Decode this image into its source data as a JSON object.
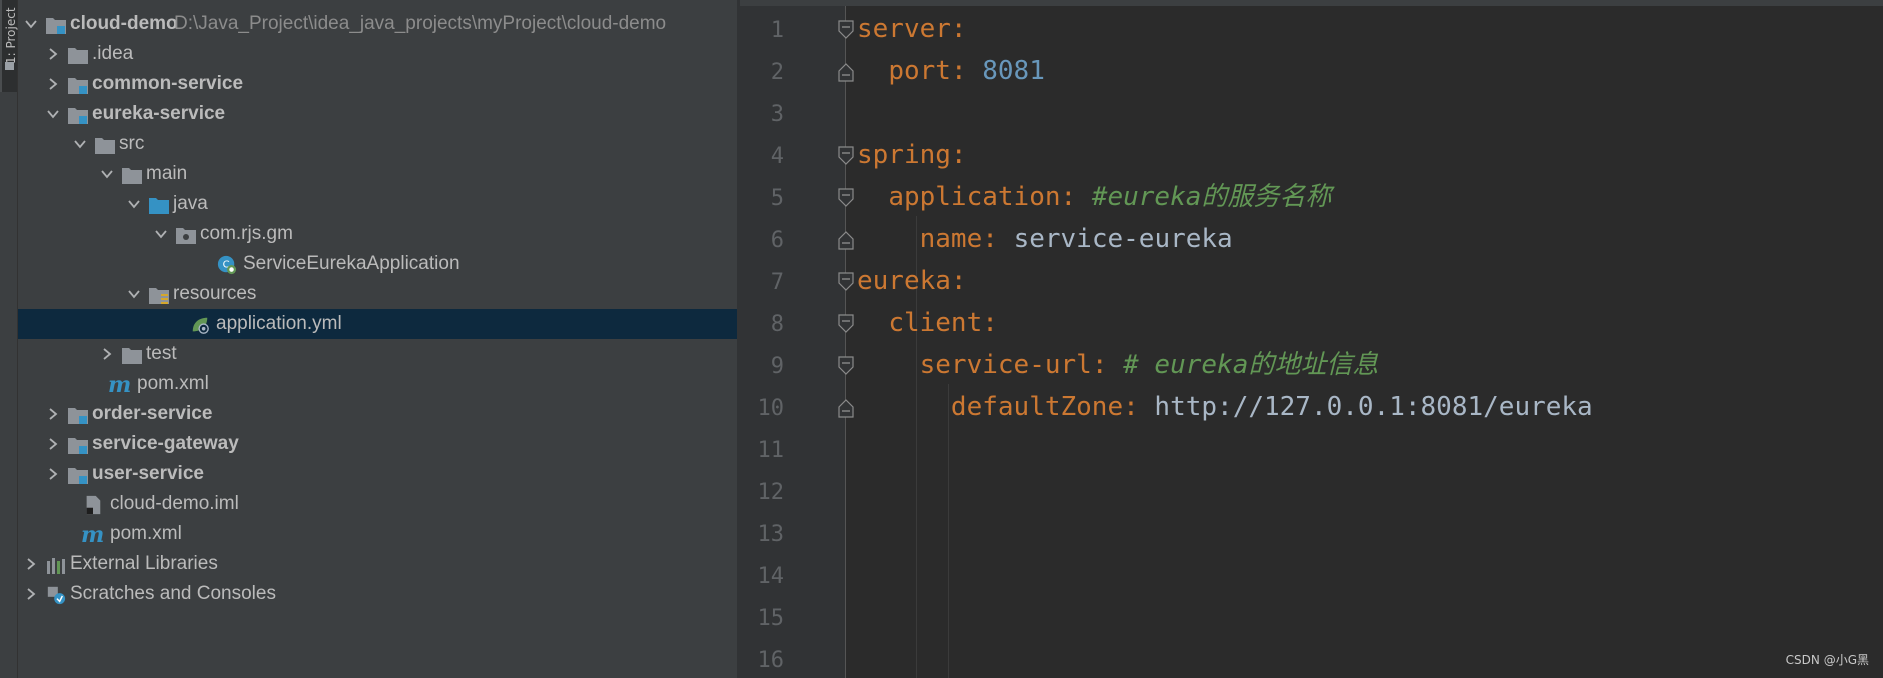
{
  "tool_window": {
    "tab_label": "1: Project"
  },
  "project_tree": {
    "root": {
      "label": "cloud-demo",
      "path": "D:\\Java_Project\\idea_java_projects\\myProject\\cloud-demo"
    },
    "rows": [
      {
        "label": ".idea"
      },
      {
        "label": "common-service"
      },
      {
        "label": "eureka-service"
      },
      {
        "label": "src"
      },
      {
        "label": "main"
      },
      {
        "label": "java"
      },
      {
        "label": "com.rjs.gm"
      },
      {
        "label": "ServiceEurekaApplication"
      },
      {
        "label": "resources"
      },
      {
        "label": "application.yml"
      },
      {
        "label": "test"
      },
      {
        "label": "pom.xml"
      },
      {
        "label": "order-service"
      },
      {
        "label": "service-gateway"
      },
      {
        "label": "user-service"
      },
      {
        "label": "cloud-demo.iml"
      },
      {
        "label": "pom.xml"
      },
      {
        "label": "External Libraries"
      },
      {
        "label": "Scratches and Consoles"
      }
    ],
    "selected": "application.yml"
  },
  "editor": {
    "line_numbers": [
      "1",
      "2",
      "3",
      "4",
      "5",
      "6",
      "7",
      "8",
      "9",
      "10",
      "11",
      "12",
      "13",
      "14",
      "15",
      "16"
    ],
    "lines": [
      {
        "key": "server",
        "punc": ":"
      },
      {
        "key": "port",
        "punc": ":",
        "value": "8081"
      },
      {},
      {
        "key": "spring",
        "punc": ":"
      },
      {
        "key": "application",
        "punc": ":",
        "comment": "#eureka的服务名称"
      },
      {
        "key": "name",
        "punc": ":",
        "value": "service-eureka"
      },
      {
        "key": "eureka",
        "punc": ":"
      },
      {
        "key": "client",
        "punc": ":"
      },
      {
        "key": "service-url",
        "punc": ":",
        "comment": "# eureka的地址信息"
      },
      {
        "key": "defaultZone",
        "punc": ":",
        "value": "http://127.0.0.1:8081/eureka"
      }
    ]
  },
  "watermark": "CSDN @小G黑",
  "colors": {
    "panel_bg": "#3c3f41",
    "editor_bg": "#2b2b2b",
    "selection": "#0d293e",
    "yaml_key": "#cc7832",
    "number": "#6897bb",
    "comment": "#629755",
    "text": "#a9b7c6",
    "folder": "#8e9399",
    "source_folder": "#3592c4"
  }
}
